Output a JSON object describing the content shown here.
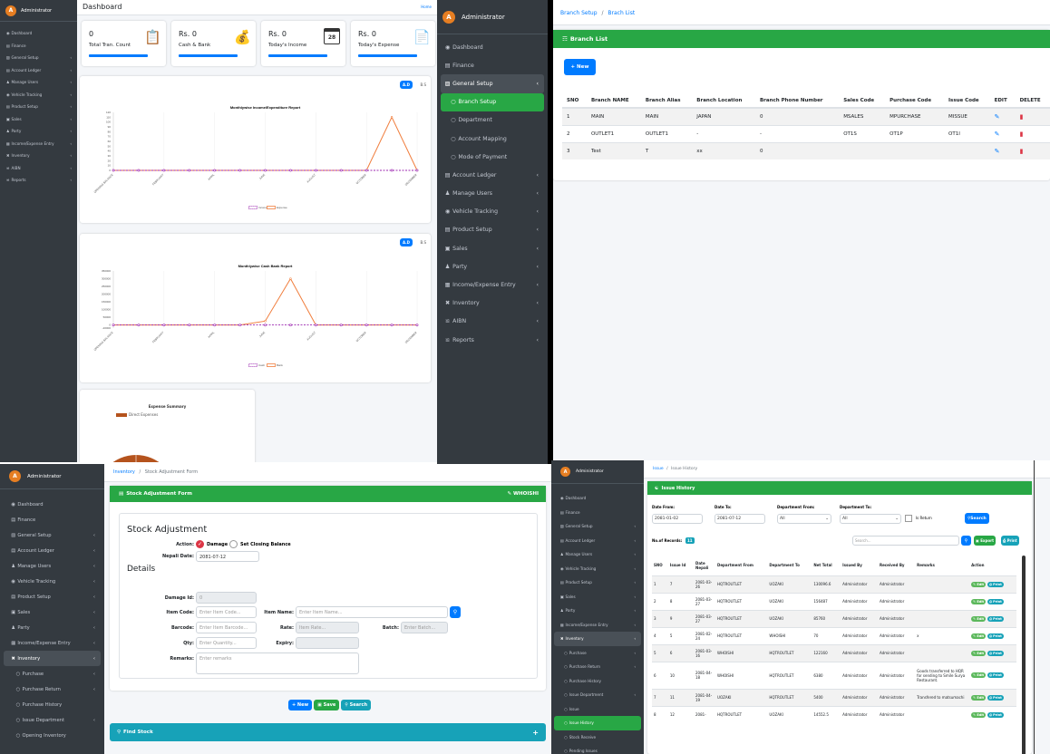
{
  "dash": {
    "admin": "Administrator",
    "title": "Dashboard",
    "home": "Home",
    "menu": [
      "Dashboard",
      "Finance",
      "General Setup",
      "Account Ledger",
      "Manage Users",
      "Vehicle Tracking",
      "Product Setup",
      "Sales",
      "Party",
      "Income/Expense Entry",
      "Inventory",
      "AIBN",
      "Reports"
    ],
    "stats": [
      {
        "v": "0",
        "l": "Total Tran. Count"
      },
      {
        "v": "Rs. 0",
        "l": "Cash & Bank"
      },
      {
        "v": "Rs. 0",
        "l": "Today's Income"
      },
      {
        "v": "Rs. 0",
        "l": "Today's Expense"
      }
    ],
    "ad": "A.D",
    "bs": "B.S",
    "cal_day": "28",
    "chart1_title": "Monthlywise Income/Expenditure Report",
    "chart2_title": "Monthlywise Cash Bank Report",
    "chart3_title": "Expense Summary",
    "legend1": [
      "Income",
      "Expense"
    ],
    "legend2": [
      "Cash",
      "Bank"
    ],
    "legend3": "Direct Expenses"
  },
  "chart_data": [
    {
      "type": "line",
      "title": "Monthlywise Income/Expenditure Report",
      "x": [
        "OPENING BALANCE",
        "FEBRUARY",
        "APRIL",
        "JUNE",
        "AUGUST",
        "OCTOBER",
        "DECEMBER"
      ],
      "ylim": [
        0,
        120
      ],
      "yticks": [
        "120",
        "110",
        "100",
        "90",
        "80",
        "70",
        "60",
        "50",
        "40",
        "30",
        "20",
        "10",
        "0"
      ],
      "series": [
        {
          "name": "Income",
          "values": [
            0,
            0,
            0,
            0,
            0,
            0,
            0,
            0,
            0,
            0,
            0,
            0,
            0
          ]
        },
        {
          "name": "Expense",
          "values": [
            0,
            0,
            0,
            0,
            0,
            0,
            0,
            0,
            0,
            0,
            0,
            110,
            0
          ]
        }
      ]
    },
    {
      "type": "line",
      "title": "Monthlywise Cash Bank Report",
      "x": [
        "OPENING BALANCE",
        "FEBRUARY",
        "APRIL",
        "JUNE",
        "AUGUST",
        "OCTOBER",
        "DECEMBER"
      ],
      "ylim": [
        -20000,
        350000
      ],
      "yticks": [
        "350000",
        "300000",
        "250000",
        "200000",
        "150000",
        "100000",
        "50000",
        "0",
        "-20000"
      ],
      "series": [
        {
          "name": "Cash",
          "values": [
            0,
            0,
            0,
            0,
            0,
            0,
            0,
            0,
            0,
            0,
            0,
            0,
            0
          ]
        },
        {
          "name": "Bank",
          "values": [
            0,
            0,
            0,
            0,
            0,
            0,
            25000,
            300000,
            0,
            0,
            0,
            0,
            0
          ]
        }
      ]
    },
    {
      "type": "pie",
      "title": "Expense Summary",
      "categories": [
        "Direct Expenses"
      ],
      "values": [
        100
      ]
    }
  ],
  "branch": {
    "admin": "Administrator",
    "menu": [
      "Dashboard",
      "Finance",
      "General Setup",
      "Branch Setup",
      "Department",
      "Account Mapping",
      "Mode of Payment",
      "Account Ledger",
      "Manage Users",
      "Vehicle Tracking",
      "Product Setup",
      "Sales",
      "Party",
      "Income/Expense Entry",
      "Inventory",
      "AIBN",
      "Reports"
    ],
    "crumb1": "Branch Setup",
    "crumb2": "Brach List",
    "title": "Branch List",
    "new": "+ New",
    "cols": [
      "SNO",
      "Branch NAME",
      "Branch Alias",
      "Branch Location",
      "Branch Phone Number",
      "Sales Code",
      "Purchase Code",
      "Issue Code",
      "EDIT",
      "DELETE"
    ],
    "rows": [
      [
        "1",
        "MAIN",
        "MAIN",
        "JAPAN",
        "0",
        "MSALES",
        "MPURCHASE",
        "MISSUE"
      ],
      [
        "2",
        "OUTLET1",
        "OUTLET1",
        "-",
        "-",
        "OT1S",
        "OT1P",
        "OT1I"
      ],
      [
        "3",
        "Test",
        "T",
        "xx",
        "0",
        "",
        "",
        ""
      ]
    ]
  },
  "stock": {
    "admin": "Administrator",
    "menu": [
      "Dashboard",
      "Finance",
      "General Setup",
      "Account Ledger",
      "Manage Users",
      "Vehicle Tracking",
      "Product Setup",
      "Sales",
      "Party",
      "Income/Expense Entry",
      "Inventory",
      "Purchase",
      "Purchase Return",
      "Purchase History",
      "Issue Department",
      "Opening Inventory"
    ],
    "crumb1": "Inventory",
    "crumb2": "Stock Adjustment Form",
    "title": "Stock Adjustment Form",
    "store": "WHOISHI",
    "h1": "Stock Adjustment",
    "action": "Action:",
    "damage": "Damage",
    "closing": "Set Closing Balance",
    "nepali_date": "Nepali Date:",
    "nepali_val": "2081-07-12",
    "details": "Details",
    "damage_id": "Damage Id:",
    "damage_val": "0",
    "item_code": "Item Code:",
    "item_code_ph": "Enter Item Code...",
    "item_name": "Item Name:",
    "item_name_ph": "Enter Item Name...",
    "barcode": "Barcode:",
    "barcode_ph": "Enter Item Barcode...",
    "rate": "Rate:",
    "rate_ph": "Item Rate...",
    "batch": "Batch:",
    "batch_ph": "Enter Batch...",
    "qty": "Qty:",
    "qty_ph": "Enter Quantity...",
    "expiry": "Expiry:",
    "remarks": "Remarks:",
    "remarks_ph": "Enter remarks",
    "b_new": "+ New",
    "b_save": "Save",
    "b_search": "Search",
    "find": "Find Stock"
  },
  "issue": {
    "admin": "Administrator",
    "menu": [
      "Dashboard",
      "Finance",
      "General Setup",
      "Account Ledger",
      "Manage Users",
      "Vehicle Tracking",
      "Product Setup",
      "Sales",
      "Party",
      "Income/Expense Entry",
      "Inventory",
      "Purchase",
      "Purchase Return",
      "Purchase History",
      "Issue Department",
      "Issue",
      "Issue History",
      "Stock Receive",
      "Pending Issues"
    ],
    "crumb1": "Issue",
    "crumb2": "Issue History",
    "title": "Issue History",
    "date_from": "Date From:",
    "date_from_val": "2081-01-02",
    "date_to": "Date To:",
    "date_to_val": "2081-07-12",
    "dep_from": "Department From:",
    "dep_from_val": "All",
    "dep_to": "Department To:",
    "dep_to_val": "All",
    "is_return": "Is Return",
    "search": "Search",
    "records": "No.of Records:",
    "count": "11",
    "search_ph": "Search...",
    "export": "Export",
    "print": "Print",
    "cols": [
      "SNO",
      "Issue Id",
      "Date Nepali",
      "Department From",
      "Department To",
      "Net Total",
      "Issued By",
      "Received By",
      "Remarks",
      "Action"
    ],
    "rows": [
      [
        "1",
        "7",
        "2081-03-26",
        "HQTROUTLET",
        "UOZAKI",
        "130096.6",
        "Administrator",
        "Administrator",
        ""
      ],
      [
        "2",
        "8",
        "2081-03-27",
        "HQTROUTLET",
        "UOZAKI",
        "156487",
        "Administrator",
        "Administrator",
        ""
      ],
      [
        "3",
        "9",
        "2081-03-27",
        "HQTROUTLET",
        "UOZAKI",
        "85760",
        "Administrator",
        "Administrator",
        ""
      ],
      [
        "4",
        "5",
        "2081-02-24",
        "HQTROUTLET",
        "WHOISHI",
        "70",
        "Administrator",
        "Administrator",
        "x"
      ],
      [
        "5",
        "6",
        "2081-03-16",
        "WHOISHI",
        "HQTROUTLET",
        "122160",
        "Administrator",
        "Administrator",
        ""
      ],
      [
        "6",
        "10",
        "2081-04-18",
        "WHOISHI",
        "HQTROUTLET",
        "6380",
        "Administrator",
        "Administrator",
        "Goods transferred to HQR for sending to Smile Surya Restaurant."
      ],
      [
        "7",
        "11",
        "2081-04-19",
        "UOZAKI",
        "HQTROUTLET",
        "5400",
        "Administrator",
        "Administrator",
        "Transfered to matsumachi"
      ],
      [
        "8",
        "12",
        "2081-",
        "HQTROUTLET",
        "UOZAKI",
        "14552.5",
        "Administrator",
        "Administrator",
        ""
      ]
    ],
    "edit": "Edit",
    "print_btn": "Print"
  }
}
